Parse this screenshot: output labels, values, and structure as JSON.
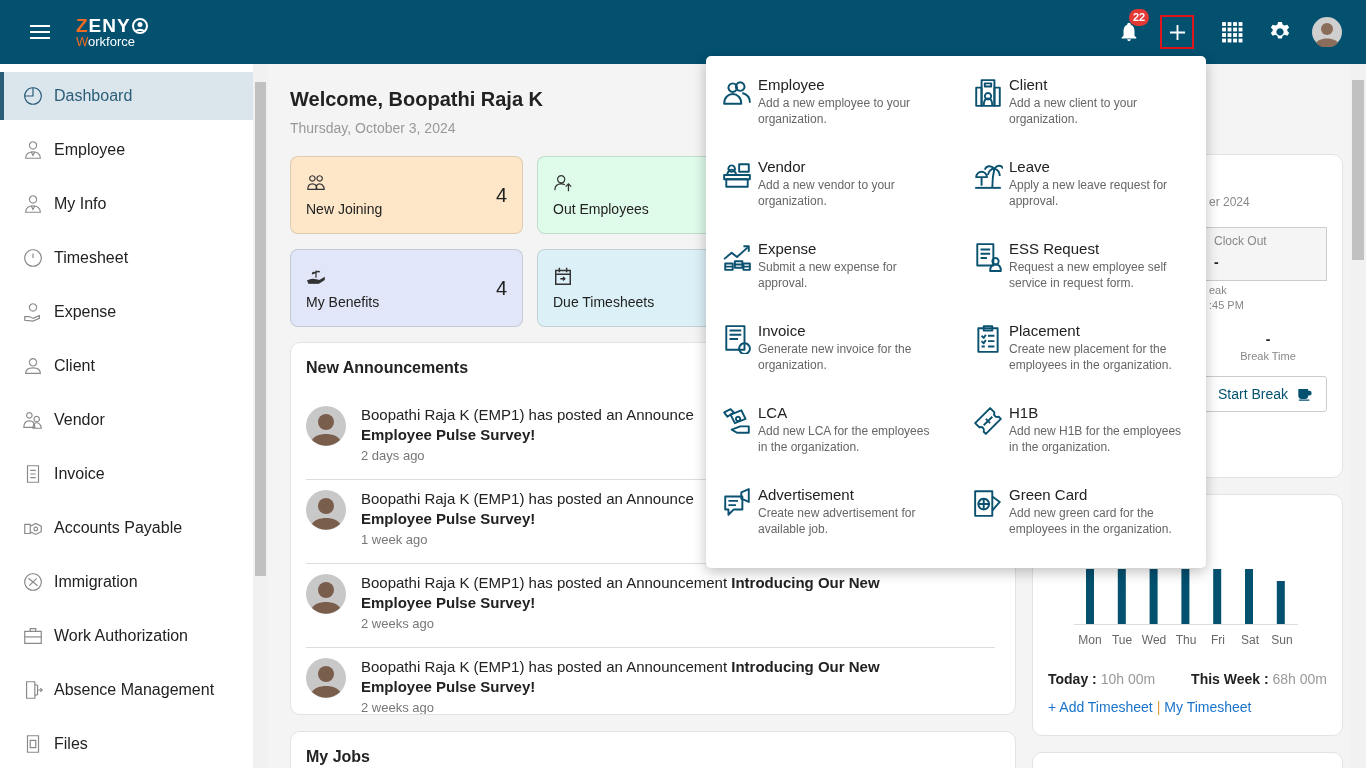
{
  "header": {
    "logo": {
      "top": "ZENY",
      "bottom": "Workforce"
    },
    "notification_count": "22"
  },
  "sidebar": {
    "items": [
      {
        "label": "Dashboard",
        "selected": true
      },
      {
        "label": "Employee",
        "selected": false
      },
      {
        "label": "My Info",
        "selected": false
      },
      {
        "label": "Timesheet",
        "selected": false
      },
      {
        "label": "Expense",
        "selected": false
      },
      {
        "label": "Client",
        "selected": false
      },
      {
        "label": "Vendor",
        "selected": false
      },
      {
        "label": "Invoice",
        "selected": false
      },
      {
        "label": "Accounts Payable",
        "selected": false
      },
      {
        "label": "Immigration",
        "selected": false
      },
      {
        "label": "Work Authorization",
        "selected": false
      },
      {
        "label": "Absence Management",
        "selected": false
      },
      {
        "label": "Files",
        "selected": false
      }
    ]
  },
  "welcome": {
    "title": "Welcome, Boopathi Raja K",
    "date": "Thursday, October 3, 2024"
  },
  "stat_cards": [
    {
      "label": "New Joining",
      "value": "4",
      "color": "#fee7c9"
    },
    {
      "label": "Out Employees",
      "color": "#dffbea"
    },
    {
      "label": "My Benefits",
      "value": "4",
      "color": "#e1e6f8"
    },
    {
      "label": "Due Timesheets",
      "color": "#dcf1f7"
    }
  ],
  "announcements": {
    "title": "New Announcements",
    "items": [
      {
        "message": "Boopathi Raja K (EMP1) has posted an Announce",
        "subject": "Employee Pulse Survey!",
        "time": "2 days ago"
      },
      {
        "message": "Boopathi Raja K (EMP1) has posted an Announce",
        "subject": "Employee Pulse Survey!",
        "time": "1 week ago"
      },
      {
        "message": "Boopathi Raja K (EMP1) has posted an Announcement **Introducing Our New**",
        "subject": "Employee Pulse Survey!",
        "time": "2 weeks ago"
      },
      {
        "message": "Boopathi Raja K (EMP1) has posted an Announcement **Introducing Our New**",
        "subject": "Employee Pulse Survey!",
        "time": "2 weeks ago"
      }
    ]
  },
  "my_jobs": {
    "title": "My Jobs"
  },
  "attendance_card": {
    "date_fragment": "er 2024",
    "clock_out": {
      "label": "Clock Out",
      "value": "-"
    },
    "break_fragment": "eak",
    "time_fragment": ":45 PM",
    "break_time": {
      "value": "-",
      "label": "Break Time"
    },
    "start_break_button": "Start Break"
  },
  "timesheet_card": {
    "days": [
      "Mon",
      "Tue",
      "Wed",
      "Thu",
      "Fri",
      "Sat",
      "Sun"
    ],
    "today": {
      "label": "Today :",
      "value": "10h 00m"
    },
    "this_week": {
      "label": "This Week :",
      "value": "68h 00m"
    },
    "add_link": "+ Add Timesheet",
    "separator": "|",
    "my_link": "My Timesheet"
  },
  "add_menu": {
    "items": [
      {
        "title": "Employee",
        "description": "Add a new employee to your organization."
      },
      {
        "title": "Client",
        "description": "Add a new client to your organization."
      },
      {
        "title": "Vendor",
        "description": "Add a new vendor to your organization."
      },
      {
        "title": "Leave",
        "description": "Apply a new leave request for approval."
      },
      {
        "title": "Expense",
        "description": "Submit a new expense for approval."
      },
      {
        "title": "ESS Request",
        "description": "Request a new employee self service in request form."
      },
      {
        "title": "Invoice",
        "description": "Generate new invoice for the organization."
      },
      {
        "title": "Placement",
        "description": "Create new placement for the employees in the organization."
      },
      {
        "title": "LCA",
        "description": "Add new LCA for the employees in the organization."
      },
      {
        "title": "H1B",
        "description": "Add new H1B for the employees in the organization."
      },
      {
        "title": "Advertisement",
        "description": "Create new advertisement for available job."
      },
      {
        "title": "Green Card",
        "description": "Add new green card for the employees in the organization."
      }
    ]
  }
}
